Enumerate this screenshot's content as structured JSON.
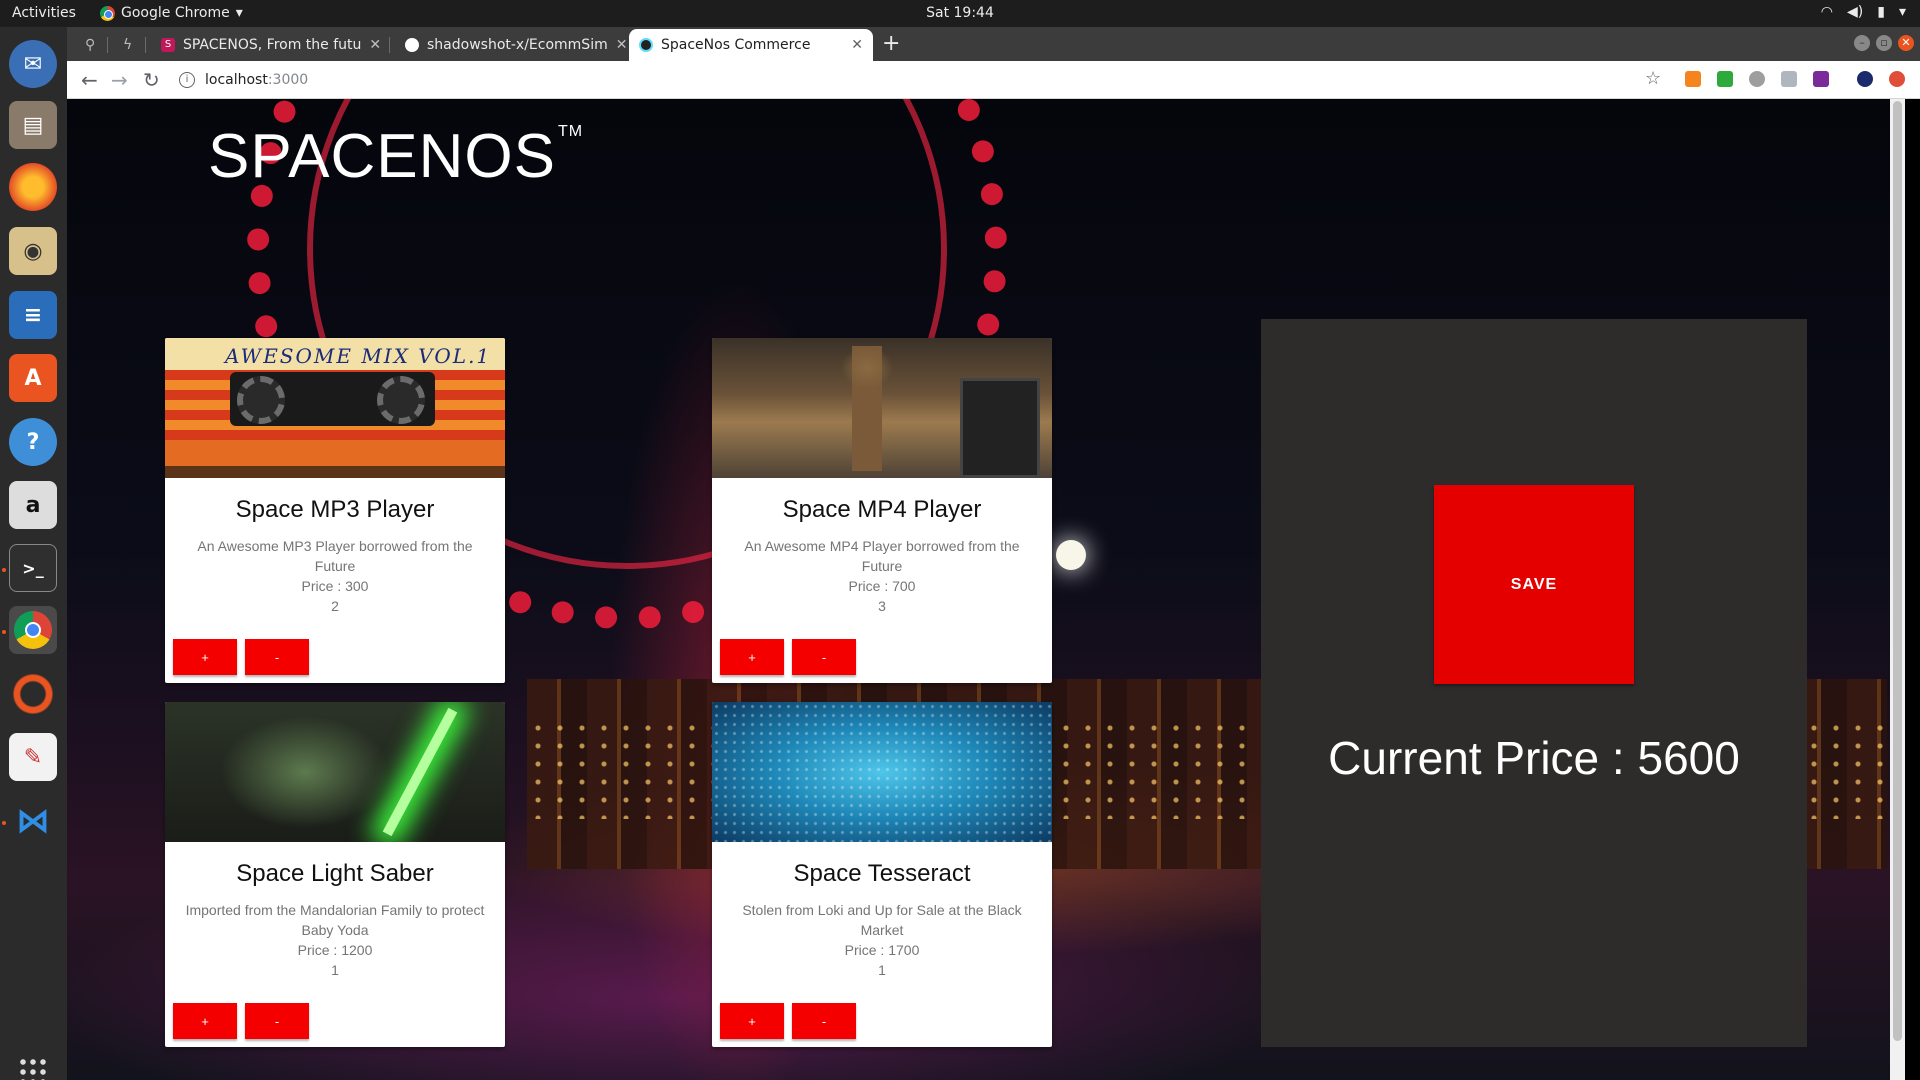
{
  "system": {
    "activities": "Activities",
    "app_name": "Google Chrome",
    "clock": "Sat 19:44",
    "tray_icons": [
      "wifi-icon",
      "volume-icon",
      "battery-icon",
      "chevron-down-icon"
    ]
  },
  "dock": {
    "items": [
      "thunderbird",
      "files",
      "firefox",
      "rhythmbox",
      "libreoffice-writer",
      "ubuntu-software",
      "help",
      "amazon",
      "terminal",
      "chrome",
      "ubuntu-updater",
      "text-editor",
      "vscode"
    ],
    "active": "chrome"
  },
  "browser": {
    "tabs": [
      {
        "label": "",
        "favicon": "pin-icon"
      },
      {
        "label": "",
        "favicon": "bolt-icon"
      },
      {
        "label": "SPACENOS, From the futu",
        "favicon": "S"
      },
      {
        "label": "shadowshot-x/EcommSim",
        "favicon": "github-icon"
      },
      {
        "label": "SpaceNos Commerce",
        "favicon": "react-icon",
        "active": true
      }
    ],
    "new_tab": "+",
    "url_host": "localhost",
    "url_port": ":3000"
  },
  "store": {
    "brand": "SPACENOS",
    "trademark": "TM",
    "plus_label": "+",
    "minus_label": "-",
    "products": [
      {
        "name": "Space MP3 Player",
        "description": "An Awesome MP3 Player borrowed from the Future",
        "price": "Price : 300",
        "quantity": "2",
        "image_caption": "AWESOME MIX VOL.1"
      },
      {
        "name": "Space MP4 Player",
        "description": "An Awesome MP4 Player borrowed from the Future",
        "price": "Price : 700",
        "quantity": "3"
      },
      {
        "name": "Space Light Saber",
        "description": "Imported from the Mandalorian Family to protect Baby Yoda",
        "price": "Price : 1200",
        "quantity": "1"
      },
      {
        "name": "Space Tesseract",
        "description": "Stolen from Loki and Up for Sale at the Black Market",
        "price": "Price : 1700",
        "quantity": "1"
      }
    ],
    "save_label": "SAVE",
    "current_price": "Current Price : 5600"
  },
  "colors": {
    "button_red": "#f40000",
    "save_red": "#e50000",
    "cart_panel": "#2e2b2b",
    "ubuntu_orange": "#e95420"
  }
}
